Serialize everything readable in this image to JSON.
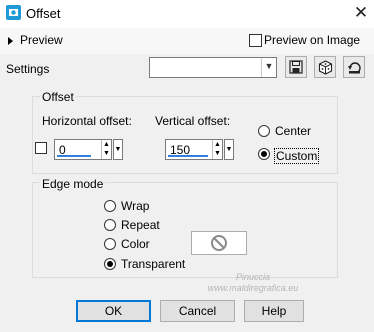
{
  "window": {
    "title": "Offset",
    "close_glyph": "✕",
    "icon": "offset-app-icon"
  },
  "preview": {
    "label": "Preview",
    "preview_on_image_label": "Preview on Image",
    "preview_on_image_checked": false
  },
  "settings": {
    "label": "Settings",
    "preset_value": "",
    "buttons": [
      "save-preset-icon",
      "random-preset-icon",
      "reset-preset-icon"
    ]
  },
  "offset": {
    "group_title": "Offset",
    "horizontal_label": "Horizontal offset:",
    "horizontal_value": "0",
    "vertical_label": "Vertical offset:",
    "vertical_value": "150",
    "link_checked": false,
    "center_label": "Center",
    "custom_label": "Custom",
    "selected": "Custom"
  },
  "edge_mode": {
    "group_title": "Edge mode",
    "options": [
      "Wrap",
      "Repeat",
      "Color",
      "Transparent"
    ],
    "selected": "Transparent",
    "color_swatch_icon": "no-color-icon"
  },
  "buttons": {
    "ok": "OK",
    "cancel": "Cancel",
    "help": "Help"
  },
  "watermark": {
    "line1": "Pinuccia",
    "line2": "www.maldiregrafica.eu"
  },
  "colors": {
    "accent": "#0078d7",
    "dialog_bg": "#f0f0f0",
    "spin_underline": "#2f80d8"
  }
}
